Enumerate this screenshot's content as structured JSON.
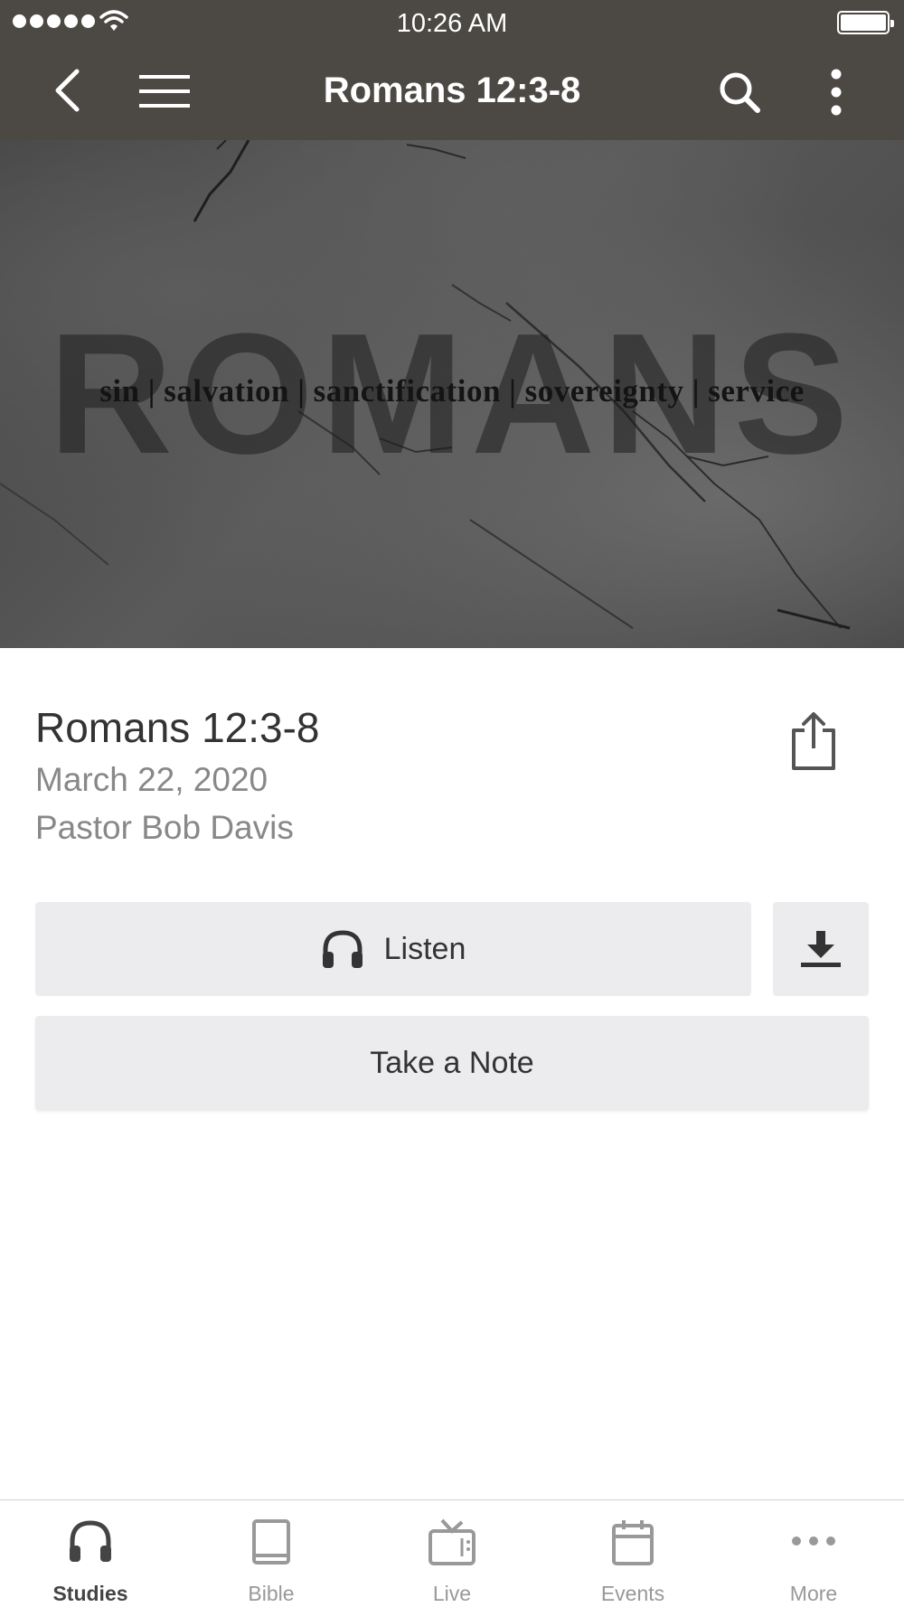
{
  "status_bar": {
    "time": "10:26 AM"
  },
  "nav": {
    "title": "Romans 12:3-8",
    "back_icon": "chevron-left-icon",
    "menu_icon": "hamburger-icon",
    "search_icon": "search-icon",
    "more_icon": "vertical-dots-icon"
  },
  "hero": {
    "word": "ROMANS",
    "tagline": "sin | salvation | sanctification | sovereignty | service"
  },
  "sermon": {
    "title": "Romans 12:3-8",
    "date": "March 22, 2020",
    "speaker": "Pastor Bob Davis"
  },
  "actions": {
    "listen_label": "Listen",
    "note_label": "Take a Note"
  },
  "tabs": [
    {
      "label": "Studies",
      "icon": "headphones-icon",
      "active": true
    },
    {
      "label": "Bible",
      "icon": "book-icon",
      "active": false
    },
    {
      "label": "Live",
      "icon": "tv-icon",
      "active": false
    },
    {
      "label": "Events",
      "icon": "calendar-icon",
      "active": false
    },
    {
      "label": "More",
      "icon": "more-dots-icon",
      "active": false
    }
  ],
  "colors": {
    "nav_background": "#4c4944",
    "button_background": "#ececee",
    "active_tab": "#444444",
    "inactive_tab": "#999999"
  }
}
